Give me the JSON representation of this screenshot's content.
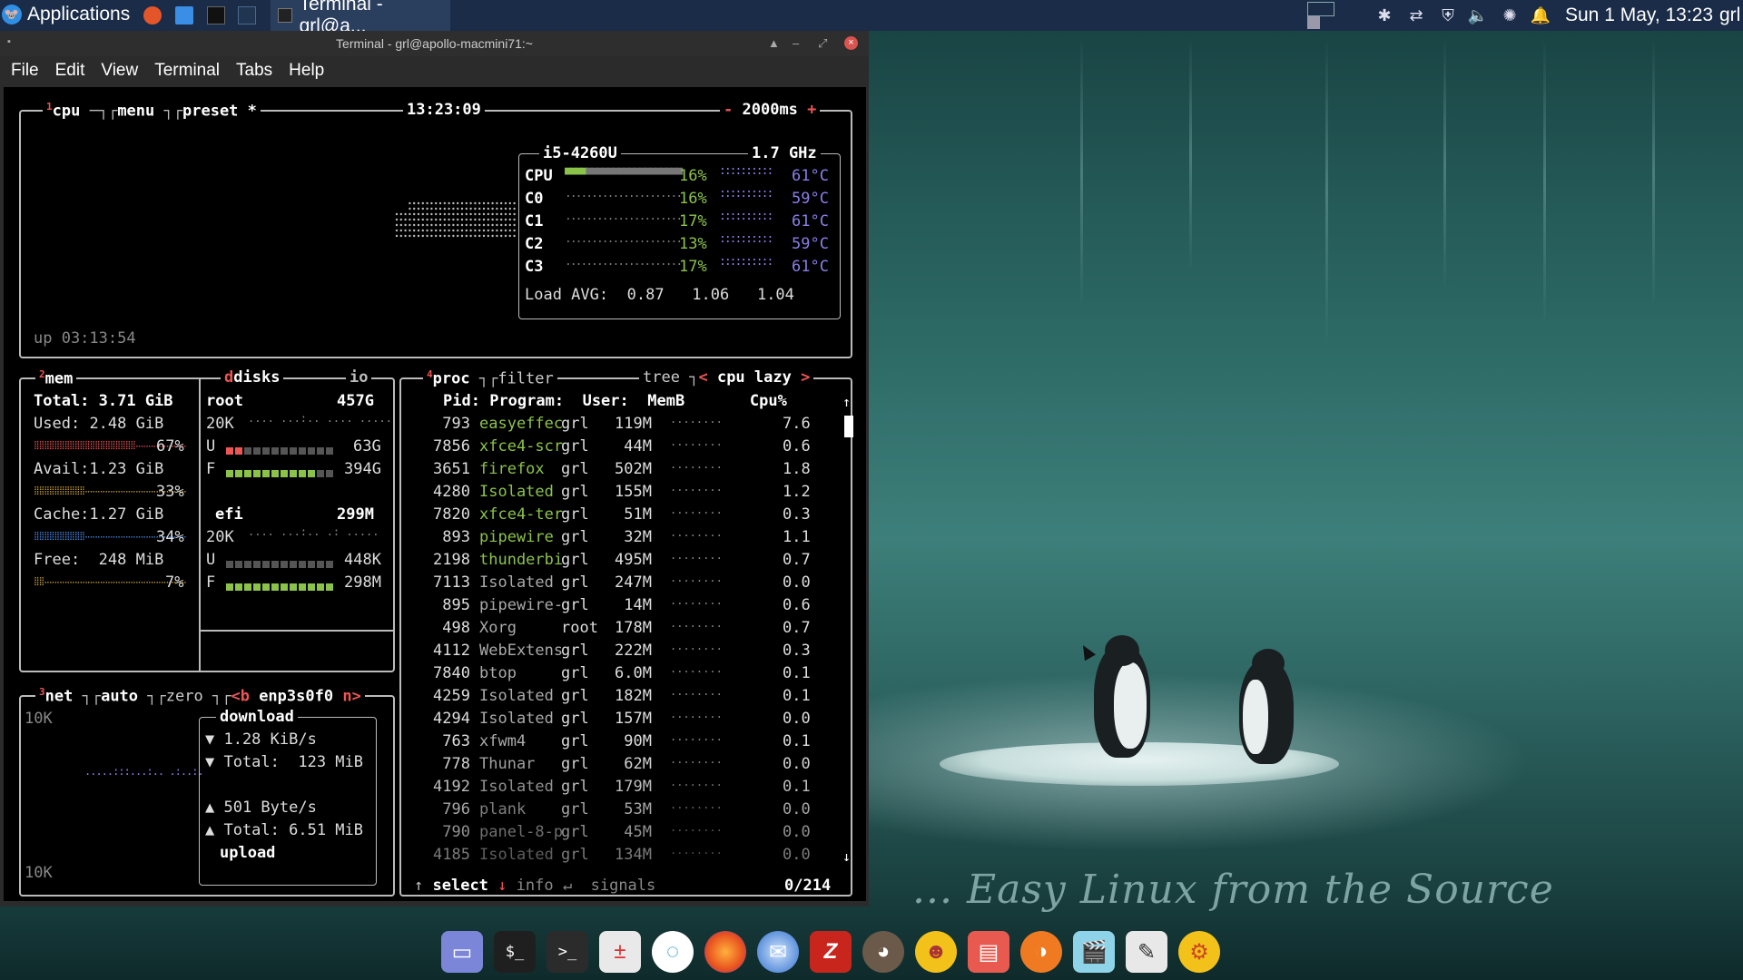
{
  "panel": {
    "applications_label": "Applications",
    "task_title": "Terminal - grl@a...",
    "clock": "Sun  1 May, 13:23",
    "user": "grl"
  },
  "window": {
    "title": "Terminal - grl@apollo-macmini71:~",
    "menu": [
      "File",
      "Edit",
      "View",
      "Terminal",
      "Tabs",
      "Help"
    ]
  },
  "btop": {
    "cpu_box": {
      "tabs": {
        "num": "1",
        "cpu": "cpu",
        "menu": "menu",
        "preset": "preset *"
      },
      "time": "13:23:09",
      "interval_minus": "-",
      "interval": "2000ms",
      "interval_plus": "+",
      "model": "i5-4260U",
      "freq": "1.7 GHz",
      "rows": [
        {
          "label": "CPU",
          "pct": "16%",
          "temp": "61°C",
          "fill": 0.16
        },
        {
          "label": "C0",
          "pct": "16%",
          "temp": "59°C",
          "fill": 0.16
        },
        {
          "label": "C1",
          "pct": "17%",
          "temp": "61°C",
          "fill": 0.17
        },
        {
          "label": "C2",
          "pct": "13%",
          "temp": "59°C",
          "fill": 0.13
        },
        {
          "label": "C3",
          "pct": "17%",
          "temp": "61°C",
          "fill": 0.17
        }
      ],
      "load_label": "Load AVG:",
      "load": [
        "0.87",
        "1.06",
        "1.04"
      ],
      "uptime": "up 03:13:54"
    },
    "mem_box": {
      "num": "2",
      "title": "mem",
      "total": "Total: 3.71 GiB",
      "used_label": "Used:",
      "used": "2.48 GiB",
      "used_pct": "67%",
      "avail_label": "Avail:",
      "avail": "1.23 GiB",
      "avail_pct": "33%",
      "cache_label": "Cache:",
      "cache": "1.27 GiB",
      "cache_pct": "34%",
      "free_label": "Free:",
      "free": "248 MiB",
      "free_pct": "7%"
    },
    "disks_box": {
      "title": "disks",
      "io": "io",
      "root_name": "root",
      "root_size": "457G",
      "root_io": "20K",
      "root_u": "U",
      "root_u_val": "63G",
      "root_f": "F",
      "root_f_val": "394G",
      "efi_name": "efi",
      "efi_size": "299M",
      "efi_io": "20K",
      "efi_u": "U",
      "efi_u_val": "448K",
      "efi_f": "F",
      "efi_f_val": "298M"
    },
    "net_box": {
      "num": "3",
      "title": "net",
      "auto": "auto",
      "zero": "zero",
      "prev": "<b",
      "iface": "enp3s0f0",
      "next": "n>",
      "scale_top": "10K",
      "scale_bottom": "10K",
      "download_label": "download",
      "dl_rate": "▼ 1.28 KiB/s",
      "dl_total": "▼ Total:  123 MiB",
      "ul_rate": "▲ 501 Byte/s",
      "ul_total": "▲ Total: 6.51 MiB",
      "upload_label": "upload"
    },
    "proc_box": {
      "num": "4",
      "title": "proc",
      "filter": "filter",
      "tree": "tree",
      "sort_prev": "<",
      "sort": "cpu lazy",
      "sort_next": ">",
      "headers": {
        "pid": "Pid:",
        "program": "Program:",
        "user": "User:",
        "mem": "MemB",
        "cpu": "Cpu%"
      },
      "rows": [
        [
          "793",
          "easyeffec",
          "grl",
          "119M",
          "7.6"
        ],
        [
          "7856",
          "xfce4-scr",
          "grl",
          "44M",
          "0.6"
        ],
        [
          "3651",
          "firefox",
          "grl",
          "502M",
          "1.8"
        ],
        [
          "4280",
          "Isolated",
          "grl",
          "155M",
          "1.2"
        ],
        [
          "7820",
          "xfce4-ter",
          "grl",
          "51M",
          "0.3"
        ],
        [
          "893",
          "pipewire",
          "grl",
          "32M",
          "1.1"
        ],
        [
          "2198",
          "thunderbi",
          "grl",
          "495M",
          "0.7"
        ],
        [
          "7113",
          "Isolated",
          "grl",
          "247M",
          "0.0"
        ],
        [
          "895",
          "pipewire-",
          "grl",
          "14M",
          "0.6"
        ],
        [
          "498",
          "Xorg",
          "root",
          "178M",
          "0.7"
        ],
        [
          "4112",
          "WebExtens",
          "grl",
          "222M",
          "0.3"
        ],
        [
          "7840",
          "btop",
          "grl",
          "6.0M",
          "0.1"
        ],
        [
          "4259",
          "Isolated",
          "grl",
          "182M",
          "0.1"
        ],
        [
          "4294",
          "Isolated",
          "grl",
          "157M",
          "0.0"
        ],
        [
          "763",
          "xfwm4",
          "grl",
          "90M",
          "0.1"
        ],
        [
          "778",
          "Thunar",
          "grl",
          "62M",
          "0.0"
        ],
        [
          "4192",
          "Isolated",
          "grl",
          "179M",
          "0.1"
        ],
        [
          "796",
          "plank",
          "grl",
          "53M",
          "0.0"
        ],
        [
          "790",
          "panel-8-p",
          "grl",
          "45M",
          "0.0"
        ],
        [
          "4185",
          "Isolated",
          "grl",
          "134M",
          "0.0"
        ]
      ],
      "footer_select": "select",
      "footer_info": "info",
      "footer_signals": "signals",
      "footer_count": "0/214"
    }
  },
  "wallpaper": {
    "tagline": "... Easy Linux from the Source"
  },
  "dock": [
    "file-manager",
    "terminal-dollar",
    "terminal-prompt",
    "calculator",
    "sync",
    "firefox",
    "thunderbird",
    "filezilla",
    "gimp",
    "mascot",
    "image-viewer",
    "orange-app",
    "media-clapper",
    "text-editor",
    "settings-gear"
  ]
}
